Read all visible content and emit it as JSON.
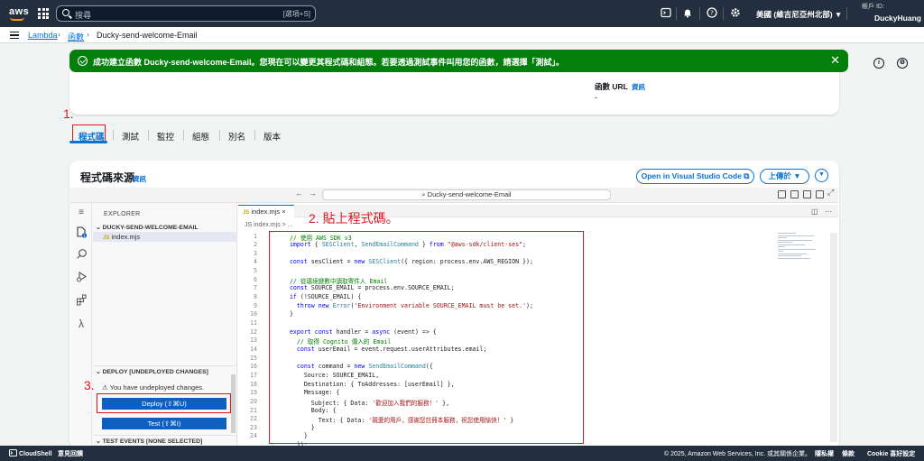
{
  "topnav": {
    "logo": "aws",
    "search_placeholder": "搜尋",
    "search_shortcut": "[選項+S]",
    "region": "美國 (維吉尼亞州北部) ▼",
    "account_id_label": "帳戶 ID:",
    "account_name": "DuckyHuang",
    "icons": [
      "cloudshell-icon",
      "bell-icon",
      "help-icon",
      "gear-icon"
    ]
  },
  "breadcrumb": {
    "items": [
      "Lambda",
      "函數",
      "Ducky-send-welcome-Email"
    ]
  },
  "flash": {
    "message": "成功建立函數 Ducky-send-welcome-Email。您現在可以變更其程式碼和組態。若要透過測試事件叫用您的函數，請選擇「測試」。"
  },
  "overview": {
    "url_label": "函數 URL",
    "info": "資訊",
    "url_value": "-"
  },
  "annotations": {
    "step1": "1.",
    "step2": "2. 貼上程式碼。",
    "step3": "3."
  },
  "tabs": [
    "程式碼",
    "測試",
    "監控",
    "組態",
    "別名",
    "版本"
  ],
  "code_source": {
    "title": "程式碼來源",
    "info": "資訊",
    "vscode_button": "Open in Visual Studio Code ⧉",
    "upload_button": "上傳於 ▼",
    "more_button": "▼"
  },
  "ide": {
    "command_center": "⌕ Ducky-send-welcome-Email",
    "explorer_title": "EXPLORER",
    "folder": "DUCKY-SEND-WELCOME-EMAIL",
    "file": "index.mjs",
    "file_badge": "JS",
    "deploy_section": "DEPLOY [UNDEPLOYED CHANGES]",
    "undeployed": "⚠ You have undeployed changes.",
    "deploy_button": "Deploy (⇧⌘U)",
    "test_button": "Test (⇧⌘I)",
    "events_section": "TEST EVENTS [NONE SELECTED]",
    "editor_tab": "index.mjs ×",
    "editor_crumbs": "JS index.mjs > ...",
    "line_numbers": [
      "1",
      "2",
      "3",
      "4",
      "5",
      "6",
      "7",
      "8",
      "9",
      "10",
      "11",
      "12",
      "13",
      "14",
      "15",
      "16",
      "17",
      "18",
      "19",
      "20",
      "21",
      "22",
      "23",
      "24"
    ]
  },
  "code": [
    "  // 使用 AWS SDK v3",
    "  import { SESClient, SendEmailCommand } from \"@aws-sdk/client-ses\";",
    "",
    "  const sesClient = new SESClient({ region: process.env.AWS_REGION });",
    "",
    "  // 從環境變數中讀取寄件人 Email",
    "  const SOURCE_EMAIL = process.env.SOURCE_EMAIL;",
    "  if (!SOURCE_EMAIL) {",
    "    throw new Error('Environment variable SOURCE_EMAIL must be set.');",
    "  }",
    "",
    "  export const handler = async (event) => {",
    "    // 取得 Cognito 傳入的 Email",
    "    const userEmail = event.request.userAttributes.email;",
    "",
    "    const command = new SendEmailCommand({",
    "      Source: SOURCE_EMAIL,",
    "      Destination: { ToAddresses: [userEmail] },",
    "      Message: {",
    "        Subject: { Data: '歡迎加入我們的服務！' },",
    "        Body: {",
    "          Text: { Data: '親愛的用戶，感謝您註冊本服務，祝您使用愉快！' }",
    "        }",
    "      }",
    "    });"
  ],
  "footer": {
    "cloudshell": "CloudShell",
    "feedback": "意見回饋",
    "copyright": "© 2025, Amazon Web Services, Inc. 或其關係企業。",
    "privacy": "隱私權",
    "terms": "條款",
    "cookie": "Cookie 喜好設定"
  }
}
